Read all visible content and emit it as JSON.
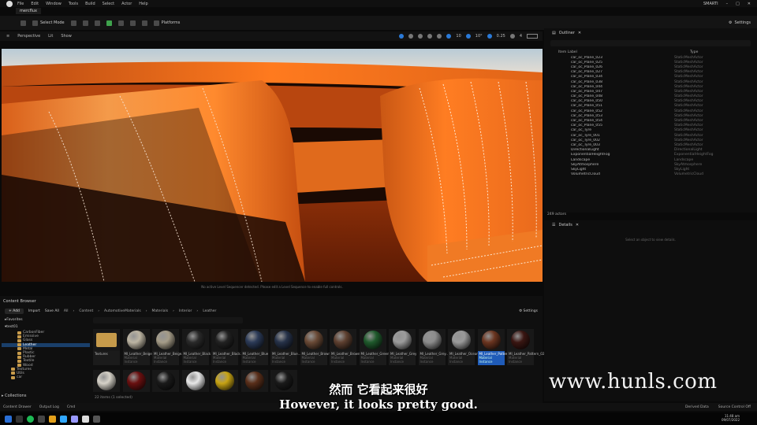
{
  "menubar": {
    "items": [
      "File",
      "Edit",
      "Window",
      "Tools",
      "Build",
      "Select",
      "Actor",
      "Help"
    ],
    "project": "mercflux",
    "user": "SMARTI"
  },
  "toolbar": {
    "select_mode": "Select Mode",
    "platforms": "Platforms",
    "settings": "Settings"
  },
  "viewport": {
    "perspective": "Perspective",
    "lit": "Lit",
    "show": "Show",
    "stats": [
      "10",
      "10°",
      "0.25",
      "4"
    ],
    "message": "No active Level Sequencer detected. Please edit a Level Sequence to enable full controls."
  },
  "outliner": {
    "title": "Outliner",
    "col_label": "Item Label",
    "col_type": "Type",
    "rows": [
      {
        "label": "car_oc_Plane_023",
        "type": "StaticMeshActor"
      },
      {
        "label": "car_oc_Plane_025",
        "type": "StaticMeshActor"
      },
      {
        "label": "car_oc_Plane_026",
        "type": "StaticMeshActor"
      },
      {
        "label": "car_oc_Plane_027",
        "type": "StaticMeshActor"
      },
      {
        "label": "car_oc_Plane_034",
        "type": "StaticMeshActor"
      },
      {
        "label": "car_oc_Plane_038",
        "type": "StaticMeshActor"
      },
      {
        "label": "car_oc_Plane_044",
        "type": "StaticMeshActor"
      },
      {
        "label": "car_oc_Plane_047",
        "type": "StaticMeshActor"
      },
      {
        "label": "car_oc_Plane_048",
        "type": "StaticMeshActor"
      },
      {
        "label": "car_oc_Plane_050",
        "type": "StaticMeshActor"
      },
      {
        "label": "car_oc_Plane_051",
        "type": "StaticMeshActor"
      },
      {
        "label": "car_oc_Plane_052",
        "type": "StaticMeshActor"
      },
      {
        "label": "car_oc_Plane_053",
        "type": "StaticMeshActor"
      },
      {
        "label": "car_oc_Plane_054",
        "type": "StaticMeshActor"
      },
      {
        "label": "car_oc_Plane_055",
        "type": "StaticMeshActor"
      },
      {
        "label": "car_oc_Tyre",
        "type": "StaticMeshActor"
      },
      {
        "label": "car_oc_Tyre_001",
        "type": "StaticMeshActor"
      },
      {
        "label": "car_oc_Tyre_002",
        "type": "StaticMeshActor"
      },
      {
        "label": "car_oc_Tyre_003",
        "type": "StaticMeshActor"
      },
      {
        "label": "DirectionalLight",
        "type": "DirectionalLight"
      },
      {
        "label": "ExponentialHeightFog",
        "type": "ExponentialHeightFog"
      },
      {
        "label": "Landscape",
        "type": "Landscape"
      },
      {
        "label": "SkyAtmosphere",
        "type": "SkyAtmosphere"
      },
      {
        "label": "SkyLight",
        "type": "SkyLight"
      },
      {
        "label": "VolumetricCloud",
        "type": "VolumetricCloud"
      }
    ],
    "actor_count": "249 actors"
  },
  "details": {
    "title": "Details",
    "message": "Select an object to view details."
  },
  "content_browser": {
    "title": "Content Browser",
    "add": "Add",
    "import": "Import",
    "save_all": "Save All",
    "breadcrumb": [
      "All",
      "Content",
      "AutomotiveMaterials",
      "Materials",
      "Interior",
      "Leather"
    ],
    "settings": "Settings",
    "favorites": "Favorites",
    "root": "test01",
    "tree": [
      {
        "label": "CarbonFiber",
        "sel": false
      },
      {
        "label": "Emissive",
        "sel": false
      },
      {
        "label": "Glass",
        "sel": false
      },
      {
        "label": "Leather",
        "sel": true
      },
      {
        "label": "Metal",
        "sel": false
      },
      {
        "label": "Plastic",
        "sel": false
      },
      {
        "label": "Rubber",
        "sel": false
      },
      {
        "label": "Textile",
        "sel": false
      },
      {
        "label": "Wood",
        "sel": false
      },
      {
        "label": "Textures",
        "sel": false
      },
      {
        "label": "Utils",
        "sel": false
      },
      {
        "label": "car",
        "sel": false
      }
    ],
    "collections": "Collections",
    "items_info": "22 items (1 selected)",
    "tiles": [
      {
        "name": "Textures",
        "sub": "",
        "color": "folder",
        "sel": false
      },
      {
        "name": "MI_Leather_Beige",
        "sub": "Material Instance",
        "color": "#bdb5a3",
        "sel": false
      },
      {
        "name": "MI_Leather_Beige...",
        "sub": "Material Instance",
        "color": "#a59c88",
        "sel": false
      },
      {
        "name": "MI_Leather_Black",
        "sub": "Material Instance",
        "color": "#2a2a2a",
        "sel": false
      },
      {
        "name": "MI_Leather_Black...",
        "sub": "Material Instance",
        "color": "#222",
        "sel": false
      },
      {
        "name": "MI_Leather_Blue",
        "sub": "Material Instance",
        "color": "#2b3a57",
        "sel": false
      },
      {
        "name": "MI_Leather_Blue...",
        "sub": "Material Instance",
        "color": "#263249",
        "sel": false
      },
      {
        "name": "MI_Leather_Brown",
        "sub": "Material Instance",
        "color": "#6a4a36",
        "sel": false
      },
      {
        "name": "MI_Leather_Brown...",
        "sub": "Material Instance",
        "color": "#5e4030",
        "sel": false
      },
      {
        "name": "MI_Leather_Green",
        "sub": "Material Instance",
        "color": "#1f5a2c",
        "sel": false
      },
      {
        "name": "MI_Leather_Grey",
        "sub": "Material Instance",
        "color": "#9c9c9c",
        "sel": false
      },
      {
        "name": "MI_Leather_Grey...",
        "sub": "Material Instance",
        "color": "#8c8c8c",
        "sel": false
      },
      {
        "name": "MI_Leather_Ocean",
        "sub": "Material Instance",
        "color": "#9a9a9a",
        "sel": false
      },
      {
        "name": "MI_Leather_Pattern_01",
        "sub": "Material Instance",
        "color": "#6b3520",
        "sel": true
      },
      {
        "name": "MI_Leather_Pattern_02",
        "sub": "Material Instance",
        "color": "#3a1612",
        "sel": false
      }
    ],
    "row2": [
      "#d6d2c8",
      "#6a1010",
      "#1a1a1a",
      "#e8e8e8",
      "#c8a414",
      "#5a2f1a",
      "#1a1a1a"
    ]
  },
  "statusbar": {
    "content_drawer": "Content Drawer",
    "output_log": "Output Log",
    "cmd": "Cmd",
    "derived_data": "Derived Data",
    "source_control": "Source Control Off"
  },
  "taskbar": {
    "time": "11:48 am",
    "date": "09/07/2022"
  },
  "subtitle": {
    "cn": "然而 它看起来很好",
    "en": "However, it looks pretty good."
  },
  "watermark": "www.hunls.com"
}
